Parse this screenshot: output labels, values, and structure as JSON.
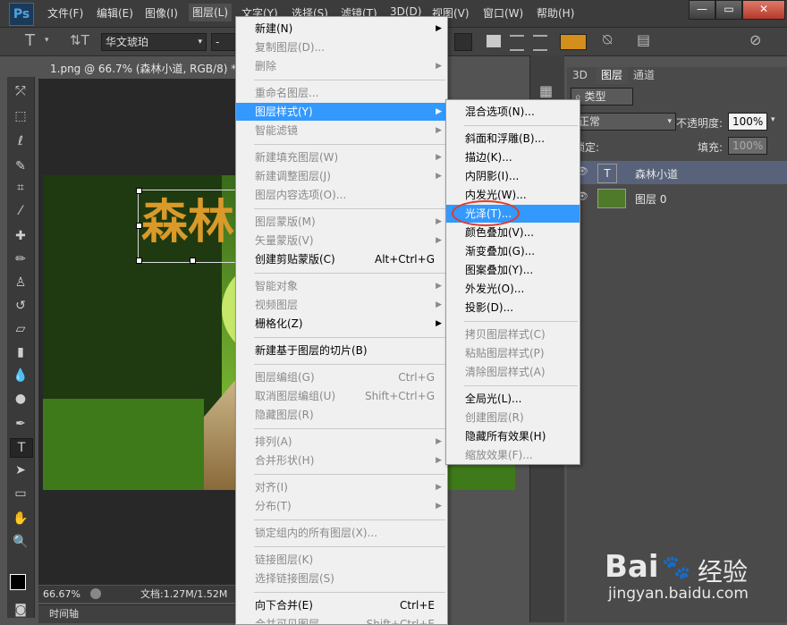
{
  "app": {
    "logo": "Ps"
  },
  "menubar": {
    "items": [
      "文件(F)",
      "编辑(E)",
      "图像(I)",
      "图层(L)",
      "文字(Y)",
      "选择(S)",
      "滤镜(T)",
      "3D(D)",
      "视图(V)",
      "窗口(W)",
      "帮助(H)"
    ]
  },
  "window_controls": {
    "minimize": "—",
    "maximize": "▭",
    "close": "✕"
  },
  "options_bar": {
    "font_family": "华文琥珀",
    "font_style": "-",
    "accent_color": "#d48e1c"
  },
  "document": {
    "tab_title": "1.png @ 66.7% (森林小道, RGB/8) *",
    "text_layer_preview": "森林",
    "status": {
      "zoom": "66.67%",
      "doc_size": "文档:1.27M/1.52M"
    },
    "timeline_label": "时间轴"
  },
  "layers_panel": {
    "tabs": [
      "3D",
      "图层",
      "通道"
    ],
    "filter_label": "类型",
    "blend_mode": "正常",
    "opacity_label": "不透明度:",
    "opacity_value": "100%",
    "lock_label": "锁定:",
    "fill_label": "填充:",
    "fill_value": "100%",
    "layers": [
      {
        "name": "森林小道",
        "type": "text",
        "thumb": "T",
        "selected": true
      },
      {
        "name": "图层 0",
        "type": "image",
        "selected": false
      }
    ]
  },
  "layer_menu": {
    "items": [
      {
        "label": "新建(N)",
        "arrow": true,
        "disabled": false
      },
      {
        "label": "复制图层(D)...",
        "disabled": true
      },
      {
        "label": "删除",
        "arrow": true,
        "disabled": true
      },
      {
        "sep": true
      },
      {
        "label": "重命名图层...",
        "disabled": true
      },
      {
        "label": "图层样式(Y)",
        "arrow": true,
        "highlighted": true
      },
      {
        "label": "智能滤镜",
        "arrow": true,
        "disabled": true
      },
      {
        "sep": true
      },
      {
        "label": "新建填充图层(W)",
        "arrow": true,
        "disabled": true
      },
      {
        "label": "新建调整图层(J)",
        "arrow": true,
        "disabled": true
      },
      {
        "label": "图层内容选项(O)...",
        "disabled": true
      },
      {
        "sep": true
      },
      {
        "label": "图层蒙版(M)",
        "arrow": true,
        "disabled": true
      },
      {
        "label": "矢量蒙版(V)",
        "arrow": true,
        "disabled": true
      },
      {
        "label": "创建剪贴蒙版(C)",
        "shortcut": "Alt+Ctrl+G"
      },
      {
        "sep": true
      },
      {
        "label": "智能对象",
        "arrow": true,
        "disabled": true
      },
      {
        "label": "视频图层",
        "arrow": true,
        "disabled": true
      },
      {
        "label": "栅格化(Z)",
        "arrow": true
      },
      {
        "sep": true
      },
      {
        "label": "新建基于图层的切片(B)"
      },
      {
        "sep": true
      },
      {
        "label": "图层编组(G)",
        "shortcut": "Ctrl+G",
        "disabled": true
      },
      {
        "label": "取消图层编组(U)",
        "shortcut": "Shift+Ctrl+G",
        "disabled": true
      },
      {
        "label": "隐藏图层(R)",
        "disabled": true
      },
      {
        "sep": true
      },
      {
        "label": "排列(A)",
        "arrow": true,
        "disabled": true
      },
      {
        "label": "合并形状(H)",
        "arrow": true,
        "disabled": true
      },
      {
        "sep": true
      },
      {
        "label": "对齐(I)",
        "arrow": true,
        "disabled": true
      },
      {
        "label": "分布(T)",
        "arrow": true,
        "disabled": true
      },
      {
        "sep": true
      },
      {
        "label": "锁定组内的所有图层(X)...",
        "disabled": true
      },
      {
        "sep": true
      },
      {
        "label": "链接图层(K)",
        "disabled": true
      },
      {
        "label": "选择链接图层(S)",
        "disabled": true
      },
      {
        "sep": true
      },
      {
        "label": "向下合并(E)",
        "shortcut": "Ctrl+E"
      },
      {
        "label": "合并可见图层",
        "shortcut": "Shift+Ctrl+E",
        "disabled": true
      }
    ]
  },
  "style_submenu": {
    "items": [
      {
        "label": "混合选项(N)..."
      },
      {
        "sep": true
      },
      {
        "label": "斜面和浮雕(B)..."
      },
      {
        "label": "描边(K)..."
      },
      {
        "label": "内阴影(I)..."
      },
      {
        "label": "内发光(W)..."
      },
      {
        "label": "光泽(T)...",
        "highlighted": true
      },
      {
        "label": "颜色叠加(V)..."
      },
      {
        "label": "渐变叠加(G)..."
      },
      {
        "label": "图案叠加(Y)..."
      },
      {
        "label": "外发光(O)..."
      },
      {
        "label": "投影(D)..."
      },
      {
        "sep": true
      },
      {
        "label": "拷贝图层样式(C)",
        "disabled": true
      },
      {
        "label": "粘贴图层样式(P)",
        "disabled": true
      },
      {
        "label": "清除图层样式(A)",
        "disabled": true
      },
      {
        "sep": true
      },
      {
        "label": "全局光(L)..."
      },
      {
        "label": "创建图层(R)",
        "disabled": true
      },
      {
        "label": "隐藏所有效果(H)"
      },
      {
        "label": "缩放效果(F)...",
        "disabled": true
      }
    ]
  },
  "watermark": {
    "brand": "Bai",
    "brand2": "经验",
    "url": "jingyan.baidu.com"
  }
}
